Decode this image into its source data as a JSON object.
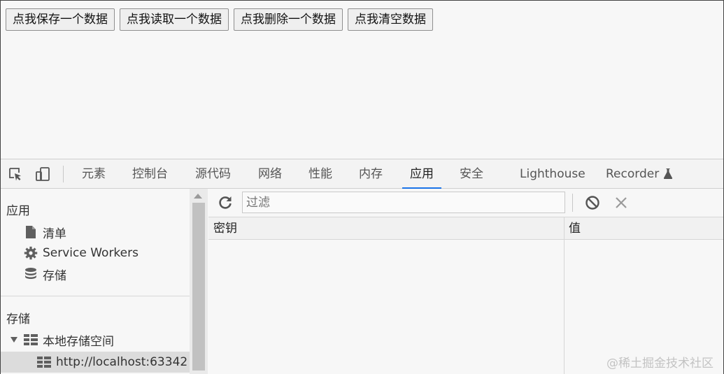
{
  "page": {
    "buttons": [
      "点我保存一个数据",
      "点我读取一个数据",
      "点我删除一个数据",
      "点我清空数据"
    ]
  },
  "devtools": {
    "tabs": [
      "元素",
      "控制台",
      "源代码",
      "网络",
      "性能",
      "内存",
      "应用",
      "安全",
      "Lighthouse",
      "Recorder"
    ],
    "active_tab": "应用",
    "accent_color": "#1a73e8"
  },
  "sidebar": {
    "section_app": "应用",
    "app_items": [
      {
        "label": "清单",
        "icon": "file-icon"
      },
      {
        "label": "Service Workers",
        "icon": "gear-icon"
      },
      {
        "label": "存储",
        "icon": "database-icon"
      }
    ],
    "section_storage": "存储",
    "local_storage": "本地存储空间",
    "local_origin": "http://localhost:63342"
  },
  "toolbar": {
    "filter_placeholder": "过滤"
  },
  "table": {
    "col_key": "密钥",
    "col_value": "值"
  },
  "watermark": "@稀土掘金技术社区"
}
